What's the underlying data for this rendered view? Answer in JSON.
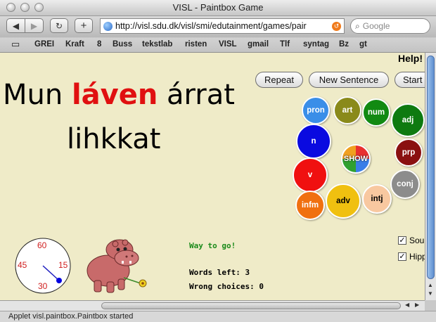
{
  "window": {
    "title": "VISL - Paintbox Game"
  },
  "toolbar": {
    "url": "http://visl.sdu.dk/visl/smi/edutainment/games/pair",
    "search_placeholder": "Google",
    "add_label": "+"
  },
  "bookmarks": [
    "GREI",
    "Kraft",
    "8",
    "Buss",
    "tekstlab",
    "risten",
    "VISL",
    "gmail",
    "Tlf",
    "syntag",
    "Bz",
    "gt"
  ],
  "game": {
    "help_label": "Help!",
    "sentence_line1": [
      {
        "text": "Mun",
        "color": "#000000"
      },
      {
        "text": "láven",
        "color": "#e01010"
      },
      {
        "text": "árrat",
        "color": "#000000"
      }
    ],
    "sentence_line2": "lihkkat",
    "buttons": {
      "repeat": "Repeat",
      "new_sentence": "New Sentence",
      "start": "Start"
    },
    "balls": {
      "pron": {
        "label": "pron",
        "color": "#3a8ee8"
      },
      "art": {
        "label": "art",
        "color": "#8a8a1a"
      },
      "num": {
        "label": "num",
        "color": "#128a12"
      },
      "adj": {
        "label": "adj",
        "color": "#0e7a10"
      },
      "n": {
        "label": "n",
        "color": "#0a0ae0"
      },
      "show": {
        "label": "SHOW"
      },
      "prp": {
        "label": "prp",
        "color": "#8a1010"
      },
      "v": {
        "label": "v",
        "color": "#f01010"
      },
      "conj": {
        "label": "conj",
        "color": "#8c8c8c"
      },
      "infm": {
        "label": "infm",
        "color": "#f07010"
      },
      "adv": {
        "label": "adv",
        "color": "#f0c010"
      },
      "intj": {
        "label": "intj",
        "color": "#f8c8a0"
      }
    },
    "feedback": "Way to go!",
    "words_left_label": "Words left:",
    "words_left": "3",
    "wrong_choices_label": "Wrong choices:",
    "wrong_choices": "0",
    "clock": {
      "mark_top": "60",
      "mark_right": "15",
      "mark_bottom": "30",
      "mark_left": "45"
    },
    "sound_label": "Sou",
    "hippo_label": "Hipp"
  },
  "statusbar": {
    "text": "Applet visl.paintbox.Paintbox started"
  },
  "colors": {
    "content_bg": "#efebc8",
    "highlight": "#e01010",
    "feedback_green": "#1a8a1a"
  }
}
